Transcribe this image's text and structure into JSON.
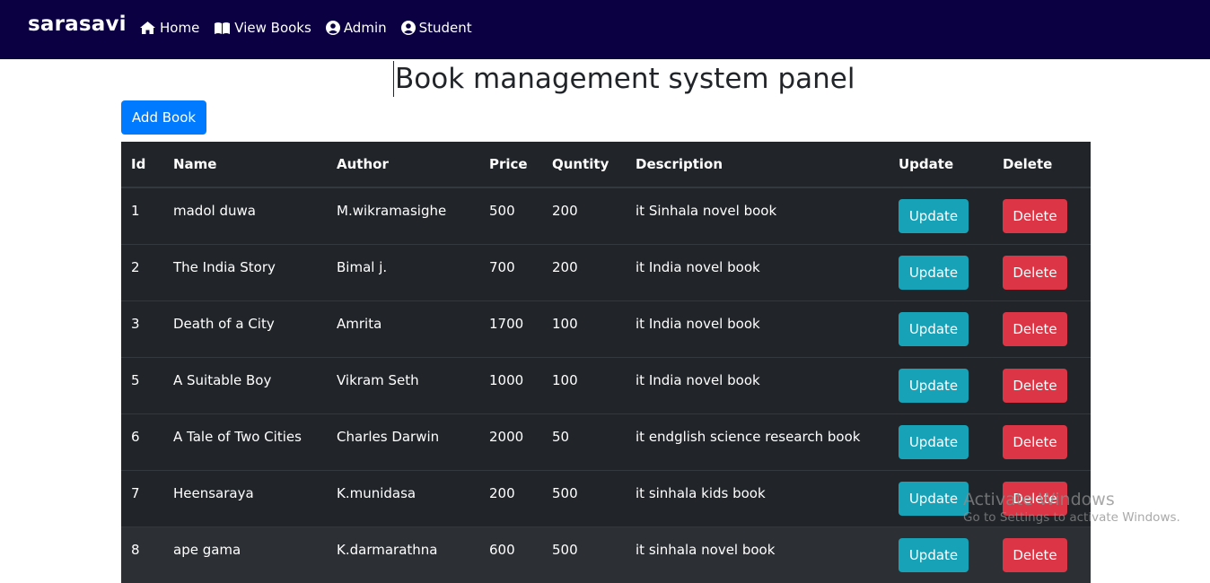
{
  "navbar": {
    "brand": "sarasavi",
    "links": [
      {
        "label": "Home",
        "icon": "home-icon"
      },
      {
        "label": "View Books",
        "icon": "book-open-icon"
      },
      {
        "label": "Admin",
        "icon": "user-circle-icon"
      },
      {
        "label": "Student",
        "icon": "user-circle-icon"
      }
    ]
  },
  "page": {
    "title": "Book management system panel",
    "add_button": "Add Book"
  },
  "table": {
    "headers": [
      "Id",
      "Name",
      "Author",
      "Price",
      "Quntity",
      "Description",
      "Update",
      "Delete"
    ],
    "update_label": "Update",
    "delete_label": "Delete",
    "rows": [
      {
        "id": "1",
        "name": "madol duwa",
        "author": "M.wikramasighe",
        "price": "500",
        "quantity": "200",
        "description": "it Sinhala novel book"
      },
      {
        "id": "2",
        "name": "The India Story",
        "author": "Bimal j.",
        "price": "700",
        "quantity": "200",
        "description": "it India novel book"
      },
      {
        "id": "3",
        "name": "Death of a City",
        "author": "Amrita",
        "price": "1700",
        "quantity": "100",
        "description": "it India novel book"
      },
      {
        "id": "5",
        "name": "A Suitable Boy",
        "author": "Vikram Seth",
        "price": "1000",
        "quantity": "100",
        "description": "it India novel book"
      },
      {
        "id": "6",
        "name": "A Tale of Two Cities",
        "author": "Charles Darwin",
        "price": "2000",
        "quantity": "50",
        "description": "it endglish science research book"
      },
      {
        "id": "7",
        "name": "Heensaraya",
        "author": "K.munidasa",
        "price": "200",
        "quantity": "500",
        "description": "it sinhala kids book"
      },
      {
        "id": "8",
        "name": "ape gama",
        "author": "K.darmarathna",
        "price": "600",
        "quantity": "500",
        "description": "it sinhala novel book"
      }
    ]
  },
  "watermark": {
    "title": "Activate Windows",
    "subtitle": "Go to Settings to activate Windows."
  }
}
